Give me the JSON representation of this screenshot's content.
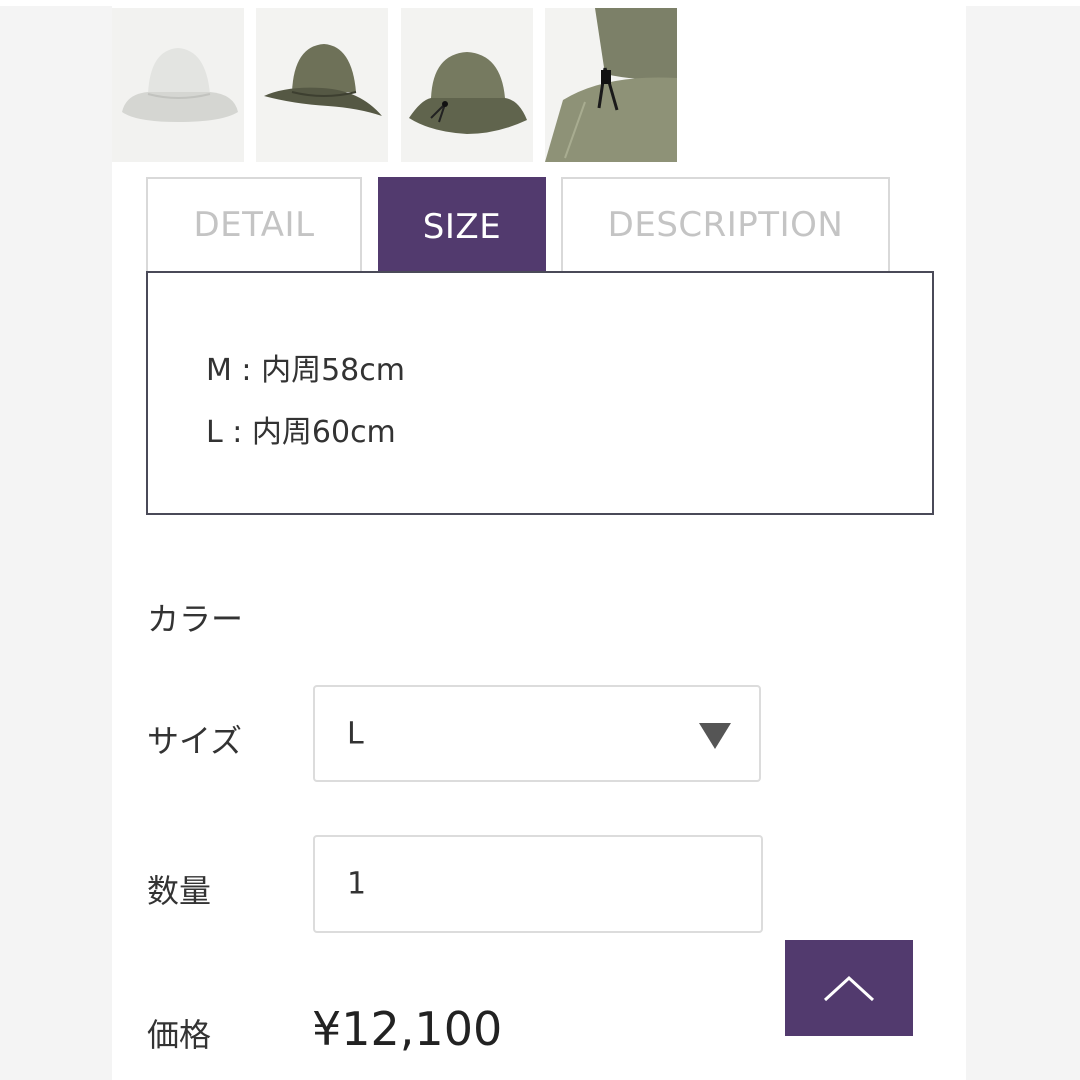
{
  "tabs": [
    {
      "label": "DETAIL",
      "active": false
    },
    {
      "label": "SIZE",
      "active": true
    },
    {
      "label": "DESCRIPTION",
      "active": false
    }
  ],
  "sizes": [
    {
      "text": "M : 内周58cm"
    },
    {
      "text": "L : 内周60cm"
    }
  ],
  "form": {
    "color_label": "カラー",
    "size_label": "サイズ",
    "size_value": "L",
    "quantity_label": "数量",
    "quantity_value": "1",
    "price_label": "価格",
    "price_value": "¥12,100"
  },
  "thumbnails": [
    {
      "icon": "bucket-hat-light-image"
    },
    {
      "icon": "bucket-hat-olive-image"
    },
    {
      "icon": "bucket-hat-cord-image"
    },
    {
      "icon": "bucket-hat-closeup-image"
    }
  ],
  "icons": {
    "size_select": "chevron-down-icon",
    "back_to_top": "chevron-up-icon"
  },
  "colors": {
    "accent": "#523a6e",
    "tab_border": "#d9d9d9",
    "box_border": "#4a4a58"
  }
}
